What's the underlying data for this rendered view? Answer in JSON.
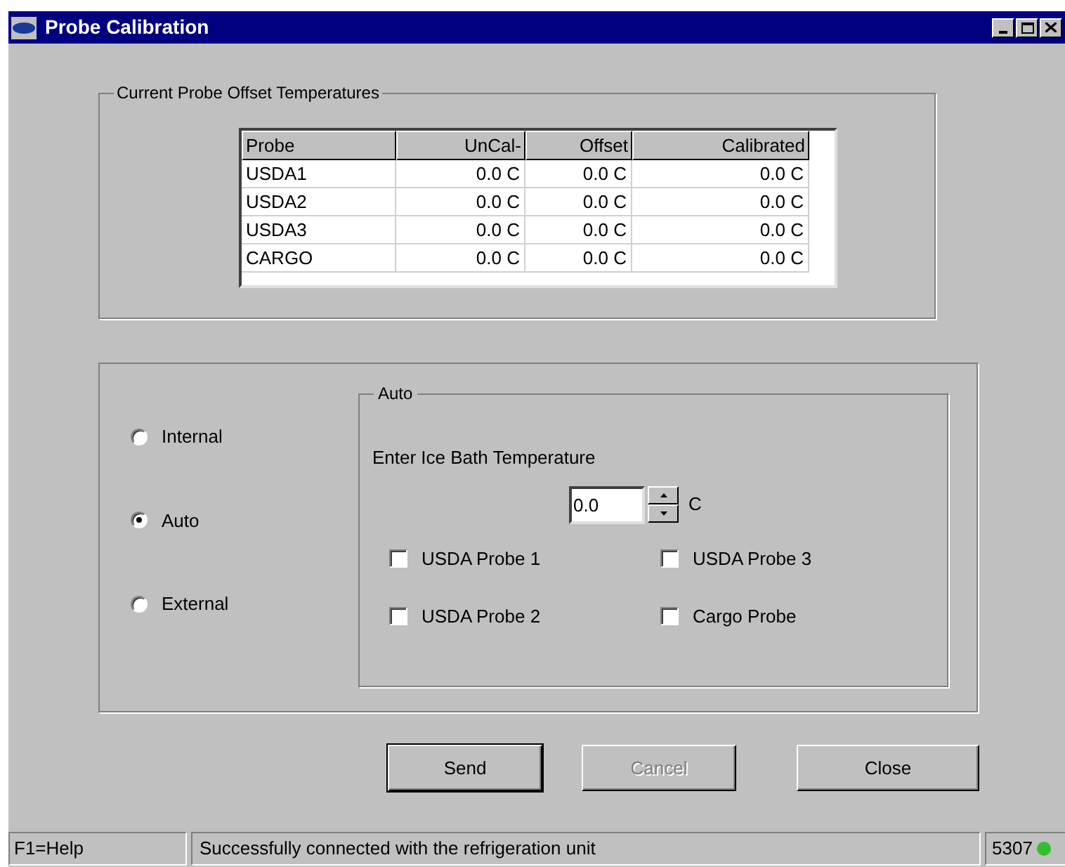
{
  "window": {
    "title": "Probe Calibration"
  },
  "offsets_group": {
    "title": "Current Probe Offset Temperatures",
    "table": {
      "columns": [
        "Probe",
        "UnCal-",
        "Offset",
        "Calibrated"
      ],
      "rows": [
        [
          "USDA1",
          "0.0 C",
          "0.0 C",
          "0.0 C"
        ],
        [
          "USDA2",
          "0.0 C",
          "0.0 C",
          "0.0 C"
        ],
        [
          "USDA3",
          "0.0 C",
          "0.0 C",
          "0.0 C"
        ],
        [
          "CARGO",
          "0.0 C",
          "0.0 C",
          "0.0 C"
        ]
      ]
    }
  },
  "modes": [
    {
      "label": "Internal",
      "selected": false
    },
    {
      "label": "Auto",
      "selected": true
    },
    {
      "label": "External",
      "selected": false
    }
  ],
  "auto_group": {
    "title": "Auto",
    "prompt": "Enter Ice Bath Temperature",
    "value": "0.0",
    "unit": "C",
    "probes": [
      {
        "label": "USDA Probe 1",
        "checked": false
      },
      {
        "label": "USDA Probe 3",
        "checked": false
      },
      {
        "label": "USDA Probe 2",
        "checked": false
      },
      {
        "label": "Cargo Probe",
        "checked": false
      }
    ]
  },
  "buttons": [
    {
      "label": "Send",
      "disabled": false,
      "default": true
    },
    {
      "label": "Cancel",
      "disabled": true,
      "default": false
    },
    {
      "label": "Close",
      "disabled": false,
      "default": false
    }
  ],
  "status_bar": {
    "help": "F1=Help",
    "message": "Successfully connected with the refrigeration unit",
    "code": "5307"
  }
}
